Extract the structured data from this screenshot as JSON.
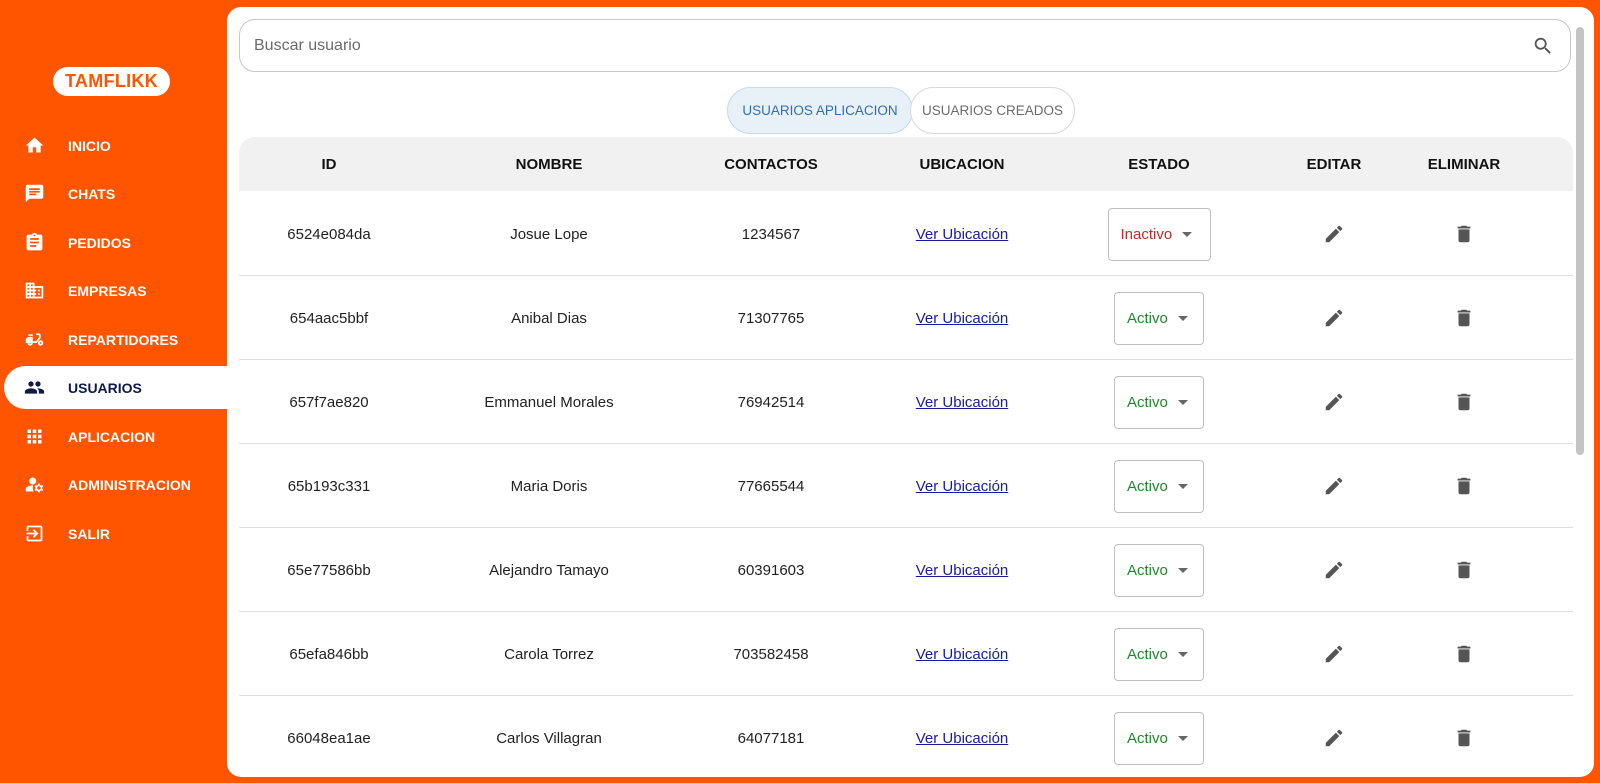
{
  "brand": {
    "logo": "TAMFLIKK"
  },
  "sidebar": {
    "items": [
      {
        "label": "INICIO",
        "icon": "home-icon"
      },
      {
        "label": "CHATS",
        "icon": "chat-icon"
      },
      {
        "label": "PEDIDOS",
        "icon": "clipboard-icon"
      },
      {
        "label": "EMPRESAS",
        "icon": "building-icon"
      },
      {
        "label": "REPARTIDORES",
        "icon": "scooter-icon"
      },
      {
        "label": "USUARIOS",
        "icon": "people-icon",
        "active": true
      },
      {
        "label": "APLICACION",
        "icon": "apps-grid-icon"
      },
      {
        "label": "ADMINISTRACION",
        "icon": "admin-user-gear-icon"
      },
      {
        "label": "SALIR",
        "icon": "exit-icon"
      }
    ]
  },
  "search": {
    "placeholder": "Buscar usuario"
  },
  "tabs": [
    {
      "label": "USUARIOS APLICACION",
      "active": true
    },
    {
      "label": "USUARIOS CREADOS",
      "active": false
    }
  ],
  "table": {
    "headers": [
      "ID",
      "NOMBRE",
      "CONTACTOS",
      "UBICACION",
      "ESTADO",
      "EDITAR",
      "ELIMINAR"
    ],
    "rows": [
      {
        "id": "6524e084da",
        "nombre": "Josue Lope",
        "contacto": "1234567",
        "ubicacion": "Ver Ubicación",
        "estado": "Inactivo"
      },
      {
        "id": "654aac5bbf",
        "nombre": "Anibal Dias",
        "contacto": "71307765",
        "ubicacion": "Ver Ubicación",
        "estado": "Activo"
      },
      {
        "id": "657f7ae820",
        "nombre": "Emmanuel Morales",
        "contacto": "76942514",
        "ubicacion": "Ver Ubicación",
        "estado": "Activo"
      },
      {
        "id": "65b193c331",
        "nombre": "Maria Doris",
        "contacto": "77665544",
        "ubicacion": "Ver Ubicación",
        "estado": "Activo"
      },
      {
        "id": "65e77586bb",
        "nombre": "Alejandro Tamayo",
        "contacto": "60391603",
        "ubicacion": "Ver Ubicación",
        "estado": "Activo"
      },
      {
        "id": "65efa846bb",
        "nombre": "Carola Torrez",
        "contacto": "703582458",
        "ubicacion": "Ver Ubicación",
        "estado": "Activo"
      },
      {
        "id": "66048ea1ae",
        "nombre": "Carlos Villagran",
        "contacto": "64077181",
        "ubicacion": "Ver Ubicación",
        "estado": "Activo"
      }
    ]
  },
  "colors": {
    "brand": "#FF5500",
    "activo": "#1f8a2a",
    "inactivo": "#c62828",
    "link": "#1a1aa6"
  }
}
